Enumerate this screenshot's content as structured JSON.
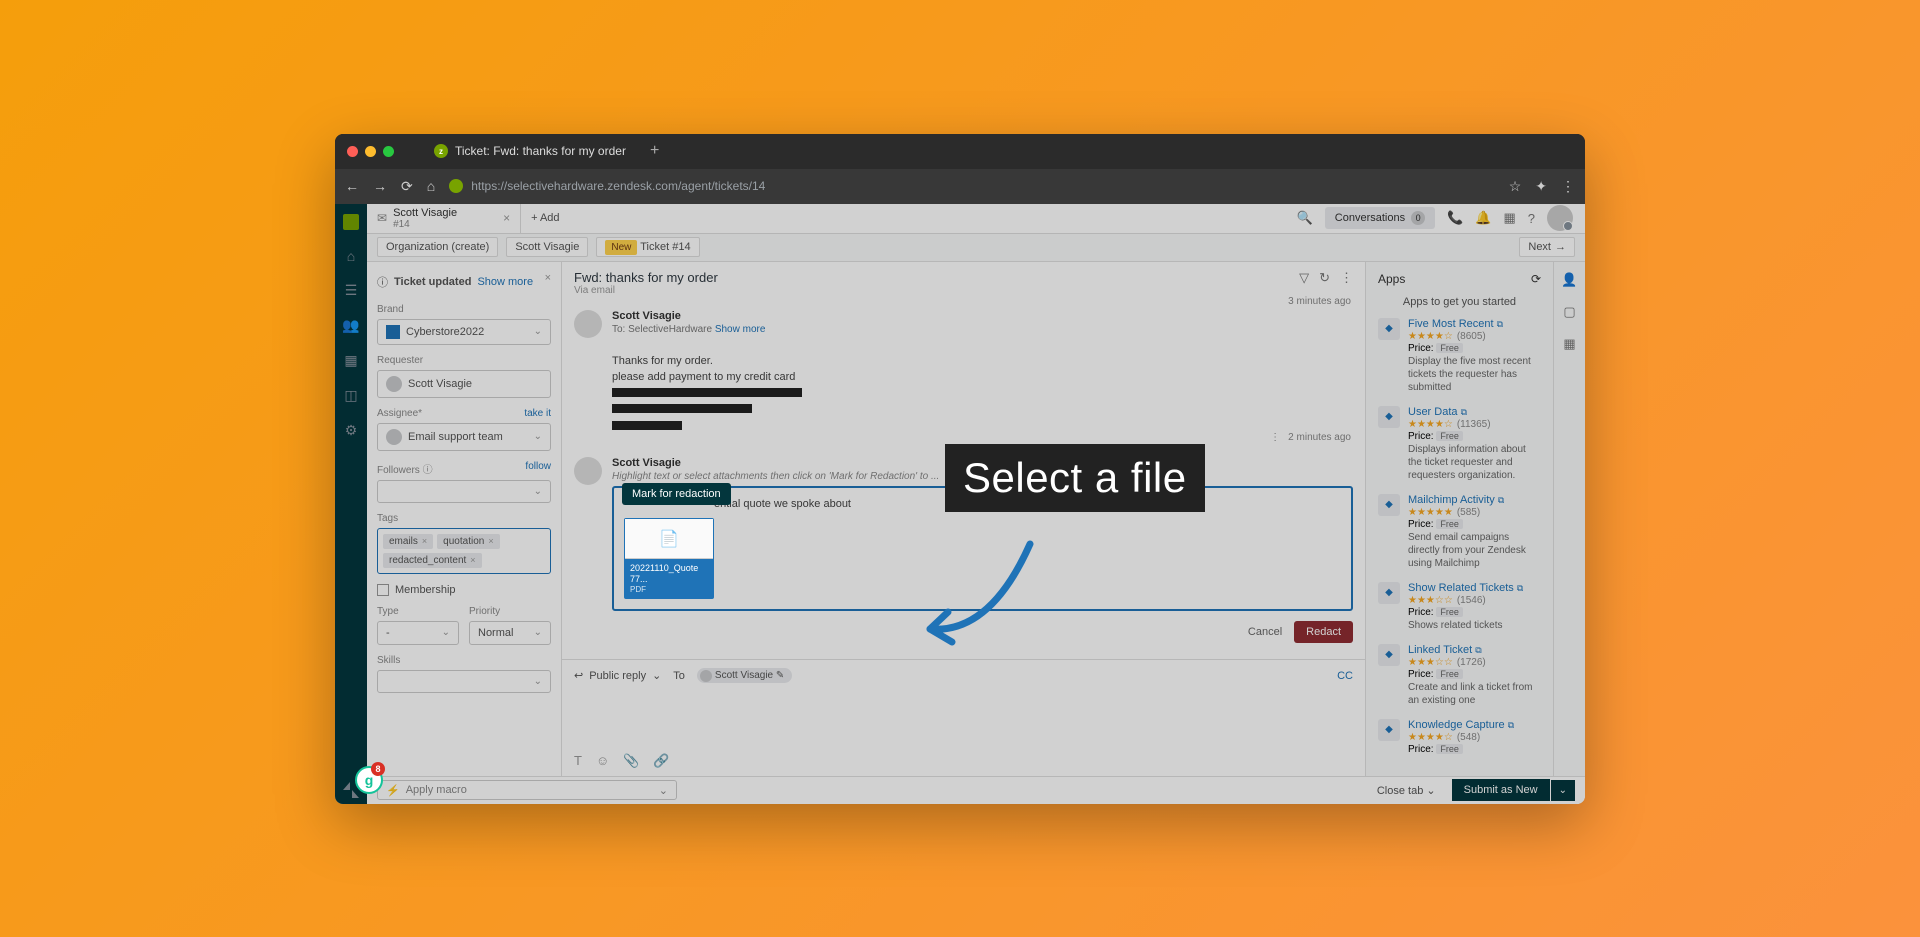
{
  "browser": {
    "tab_title": "Ticket: Fwd: thanks for my order",
    "url": "https://selectivehardware.zendesk.com/agent/tickets/14",
    "add_tab": "+ Add"
  },
  "topbar": {
    "user": "Scott Visagie",
    "ticket_no": "#14",
    "conversations": "Conversations",
    "conv_count": "0"
  },
  "breadcrumb": {
    "org": "Organization (create)",
    "user": "Scott Visagie",
    "badge": "New",
    "ticket": "Ticket #14",
    "next": "Next"
  },
  "left": {
    "banner": "Ticket updated",
    "show_more": "Show more",
    "brand": "Brand",
    "brand_val": "Cyberstore2022",
    "requester": "Requester",
    "requester_val": "Scott Visagie",
    "assignee": "Assignee*",
    "take_it": "take it",
    "assignee_val": "Email support team",
    "followers": "Followers",
    "follow": "follow",
    "tags": "Tags",
    "tag1": "emails",
    "tag2": "quotation",
    "tag3": "redacted_content",
    "membership": "Membership",
    "type": "Type",
    "type_val": "-",
    "priority": "Priority",
    "priority_val": "Normal",
    "skills": "Skills"
  },
  "main": {
    "subject": "Fwd: thanks for my order",
    "via": "Via email",
    "msg1_from": "Scott Visagie",
    "msg1_to": "To: SelectiveHardware",
    "msg1_show": "Show more",
    "msg1_time": "3 minutes ago",
    "msg1_text1": "Thanks for my order.",
    "msg1_text2": "please add payment to my credit card",
    "msg2_from": "Scott Visagie",
    "msg2_time": "2 minutes ago",
    "msg2_hint": "Highlight text or select attachments then click on 'Mark for Redaction' to ... ",
    "tooltip": "Mark for redaction",
    "mention": "ential quote we spoke about",
    "file_name": "20221110_Quote 77...",
    "file_ext": "PDF",
    "cancel": "Cancel",
    "redact": "Redact",
    "public_reply": "Public reply",
    "to": "To",
    "to_name": "Scott Visagie",
    "cc": "CC"
  },
  "right": {
    "title": "Apps",
    "subtitle": "Apps to get you started",
    "apps": [
      {
        "name": "Five Most Recent",
        "stars": "★★★★☆",
        "count": "(8605)",
        "price": "Price:",
        "free": "Free",
        "desc": "Display the five most recent tickets the requester has submitted"
      },
      {
        "name": "User Data",
        "stars": "★★★★☆",
        "count": "(11365)",
        "price": "Price:",
        "free": "Free",
        "desc": "Displays information about the ticket requester and requesters organization."
      },
      {
        "name": "Mailchimp Activity",
        "stars": "★★★★★",
        "count": "(585)",
        "price": "Price:",
        "free": "Free",
        "desc": "Send email campaigns directly from your Zendesk using Mailchimp"
      },
      {
        "name": "Show Related Tickets",
        "stars": "★★★☆☆",
        "count": "(1546)",
        "price": "Price:",
        "free": "Free",
        "desc": "Shows related tickets"
      },
      {
        "name": "Linked Ticket",
        "stars": "★★★☆☆",
        "count": "(1726)",
        "price": "Price:",
        "free": "Free",
        "desc": "Create and link a ticket from an existing one"
      },
      {
        "name": "Knowledge Capture",
        "stars": "★★★★☆",
        "count": "(548)",
        "price": "Price:",
        "free": "Free",
        "desc": ""
      }
    ]
  },
  "bottom": {
    "macro": "Apply macro",
    "close_tab": "Close tab",
    "submit": "Submit as New"
  },
  "callout": "Select a file",
  "grammarly_badge": "8"
}
